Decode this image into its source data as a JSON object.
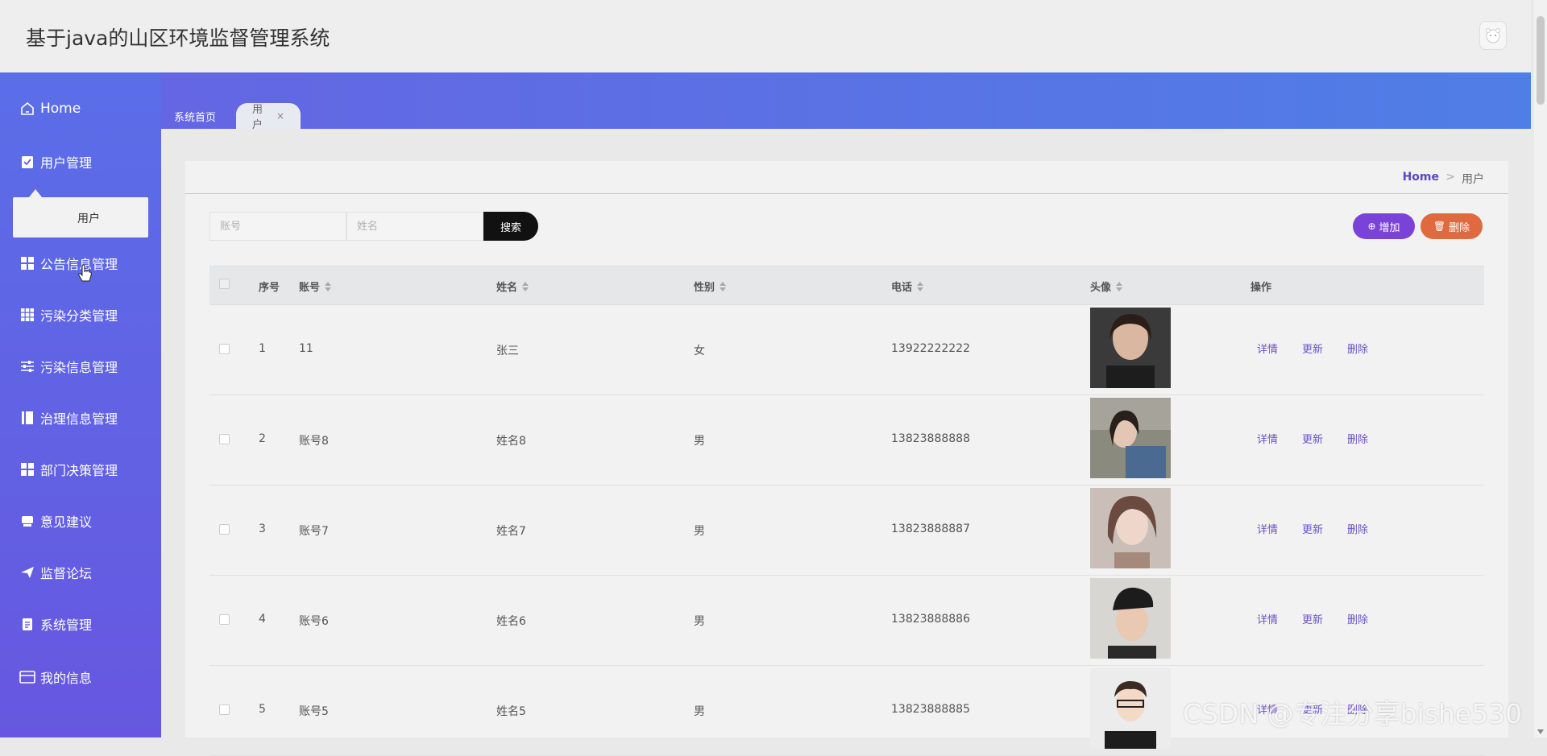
{
  "app": {
    "title": "基于java的山区环境监督管理系统"
  },
  "sidebar": {
    "items": [
      {
        "label": "Home",
        "icon": "home-icon"
      },
      {
        "label": "用户管理",
        "icon": "clipboard-check-icon"
      },
      {
        "label": "公告信息管理",
        "icon": "grid-icon"
      },
      {
        "label": "污染分类管理",
        "icon": "grid-nine-icon"
      },
      {
        "label": "污染信息管理",
        "icon": "sliders-icon"
      },
      {
        "label": "治理信息管理",
        "icon": "book-icon"
      },
      {
        "label": "部门决策管理",
        "icon": "grid-icon"
      },
      {
        "label": "意见建议",
        "icon": "inbox-icon"
      },
      {
        "label": "监督论坛",
        "icon": "paper-plane-icon"
      },
      {
        "label": "系统管理",
        "icon": "clipboard-icon"
      },
      {
        "label": "我的信息",
        "icon": "card-icon"
      }
    ],
    "submenu": {
      "label": "用户"
    }
  },
  "tabs": [
    {
      "label": "系统首页"
    },
    {
      "label": "用户",
      "close": "×"
    }
  ],
  "breadcrumb": {
    "home": "Home",
    "sep": ">",
    "current": "用户"
  },
  "search": {
    "account_placeholder": "账号",
    "name_placeholder": "姓名",
    "button": "搜索"
  },
  "actions": {
    "add": "增加",
    "delete": "删除"
  },
  "table": {
    "headers": {
      "index": "序号",
      "account": "账号",
      "name": "姓名",
      "gender": "性别",
      "phone": "电话",
      "avatar": "头像",
      "ops": "操作"
    },
    "row_actions": {
      "detail": "详情",
      "update": "更新",
      "delete": "删除"
    },
    "rows": [
      {
        "index": "1",
        "account": "11",
        "name": "张三",
        "gender": "女",
        "phone": "13922222222"
      },
      {
        "index": "2",
        "account": "账号8",
        "name": "姓名8",
        "gender": "男",
        "phone": "13823888888"
      },
      {
        "index": "3",
        "account": "账号7",
        "name": "姓名7",
        "gender": "男",
        "phone": "13823888887"
      },
      {
        "index": "4",
        "account": "账号6",
        "name": "姓名6",
        "gender": "男",
        "phone": "13823888886"
      },
      {
        "index": "5",
        "account": "账号5",
        "name": "姓名5",
        "gender": "男",
        "phone": "13823888885"
      }
    ]
  },
  "colors": {
    "sidebar_top": "#5b6ee8",
    "sidebar_bottom": "#6757e0",
    "accent": "#7a42d8",
    "danger": "#e06a3f",
    "link": "#6b53c7"
  },
  "watermark": "CSDN @专注分享bishe530"
}
